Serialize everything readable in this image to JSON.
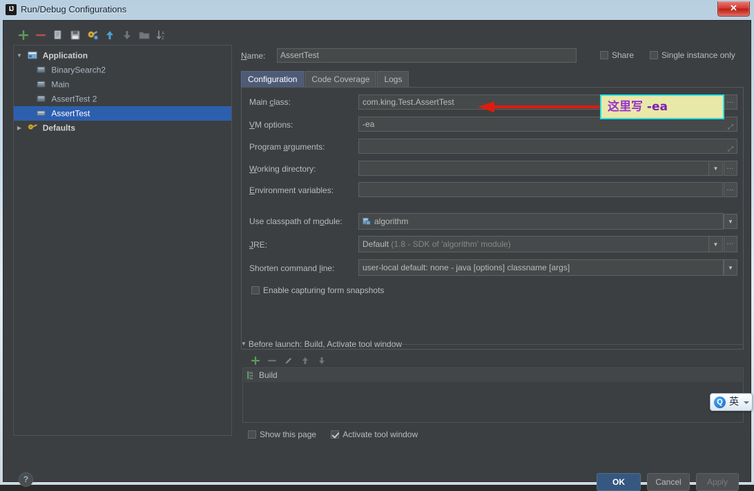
{
  "window": {
    "title": "Run/Debug Configurations",
    "app_icon": "intellij-idea-icon",
    "close_label": "✕"
  },
  "toolbar": {
    "items": [
      {
        "name": "add-configuration-icon",
        "label": "+"
      },
      {
        "name": "remove-configuration-icon",
        "label": "−"
      },
      {
        "name": "copy-configuration-icon",
        "label": "Copy"
      },
      {
        "name": "save-configuration-icon",
        "label": "Save"
      },
      {
        "name": "edit-defaults-icon",
        "label": "Edit defaults"
      },
      {
        "name": "move-up-icon",
        "label": "Move Up"
      },
      {
        "name": "move-down-icon",
        "label": "Move Down"
      },
      {
        "name": "folder-icon",
        "label": "Create folder"
      },
      {
        "name": "sort-icon",
        "label": "Sort"
      }
    ]
  },
  "tree": {
    "groups": [
      {
        "label": "Application",
        "icon": "application-icon",
        "expanded": true,
        "arrow": "▼",
        "children": [
          {
            "label": "BinarySearch2",
            "icon": "run-config-icon",
            "selected": false
          },
          {
            "label": "Main",
            "icon": "run-config-icon",
            "selected": false
          },
          {
            "label": "AssertTest 2",
            "icon": "run-config-icon",
            "selected": false
          },
          {
            "label": "AssertTest",
            "icon": "run-config-icon",
            "selected": true
          }
        ]
      },
      {
        "label": "Defaults",
        "icon": "defaults-icon",
        "expanded": false,
        "arrow": "▶",
        "children": []
      }
    ]
  },
  "header": {
    "name_label": "Name:",
    "name_value": "AssertTest",
    "name_placeholder": "",
    "share_label": "Share",
    "share_checked": false,
    "single_instance_label": "Single instance only",
    "single_instance_checked": false
  },
  "tabs": [
    {
      "label": "Configuration",
      "active": true
    },
    {
      "label": "Code Coverage",
      "active": false
    },
    {
      "label": "Logs",
      "active": false
    }
  ],
  "configuration": {
    "main_class": {
      "label": "Main class:",
      "value": "com.king.Test.AssertTest",
      "placeholder": "",
      "browse": "…"
    },
    "vm_options": {
      "label": "VM options:",
      "value": "-ea",
      "placeholder": "",
      "expand": "⤢"
    },
    "program_arguments": {
      "label": "Program arguments:",
      "value": "",
      "placeholder": "",
      "expand": "⤢"
    },
    "working_directory": {
      "label": "Working directory:",
      "value": "",
      "placeholder": "",
      "caret": "▼",
      "browse": "…"
    },
    "environment_variables": {
      "label": "Environment variables:",
      "value": "",
      "placeholder": "",
      "browse": "…"
    },
    "use_classpath": {
      "label": "Use classpath of module:",
      "value": "algorithm",
      "icon": "module-icon",
      "caret": "▼"
    },
    "jre": {
      "label": "JRE:",
      "value": "Default",
      "value_detail": "(1.8 - SDK of 'algorithm' module)",
      "caret": "▼",
      "browse": "…"
    },
    "shorten_command_line": {
      "label": "Shorten command line:",
      "value": "user-local default: none - java [options] classname [args]",
      "caret": "▼"
    },
    "enable_capturing": {
      "label": "Enable capturing form snapshots",
      "checked": false
    }
  },
  "before_launch": {
    "header": "Before launch: Build, Activate tool window",
    "arrow": "▼",
    "toolbar": [
      {
        "name": "add-task-icon",
        "label": "+"
      },
      {
        "name": "remove-task-icon",
        "label": "−"
      },
      {
        "name": "edit-task-icon",
        "label": "Edit"
      },
      {
        "name": "move-task-up-icon",
        "label": "Up"
      },
      {
        "name": "move-task-down-icon",
        "label": "Down"
      }
    ],
    "items": [
      {
        "label": "Build",
        "icon": "build-icon"
      }
    ],
    "show_this_page": {
      "label": "Show this page",
      "checked": false
    },
    "activate_tool_window": {
      "label": "Activate tool window",
      "checked": true
    }
  },
  "footer": {
    "help_label": "?",
    "ok_label": "OK",
    "cancel_label": "Cancel",
    "apply_label": "Apply",
    "apply_disabled": true
  },
  "annotation": {
    "text_cn": "这里写",
    "text_code": "-ea",
    "box_bg": "#e8e8a8",
    "box_border": "#28e0e8",
    "text_color": "#9b30d0",
    "arrow_color": "#e01b0e"
  },
  "ime": {
    "logo": "Q",
    "mode": "英",
    "caret": "▾"
  }
}
